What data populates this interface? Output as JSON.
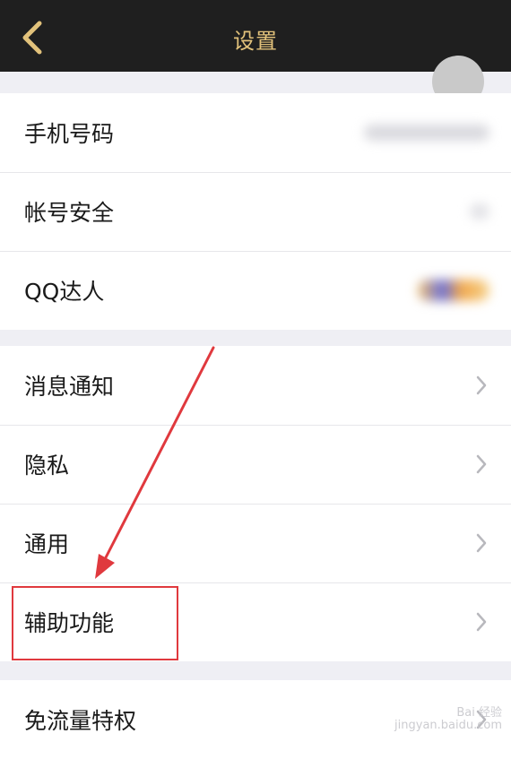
{
  "header": {
    "title": "设置",
    "back_icon": "chevron-left-icon"
  },
  "groups": [
    {
      "items": [
        {
          "label": "手机号码"
        },
        {
          "label": "帐号安全"
        },
        {
          "label": "QQ达人"
        }
      ]
    },
    {
      "items": [
        {
          "label": "消息通知"
        },
        {
          "label": "隐私"
        },
        {
          "label": "通用"
        },
        {
          "label": "辅助功能"
        }
      ]
    },
    {
      "items": [
        {
          "label": "免流量特权"
        }
      ]
    }
  ],
  "watermark": {
    "line1": "Bai  经验",
    "line2": "jingyan.baidu.com"
  },
  "colors": {
    "header_bg": "#1f1f1f",
    "title": "#e2c27b",
    "highlight": "#e0393e"
  }
}
